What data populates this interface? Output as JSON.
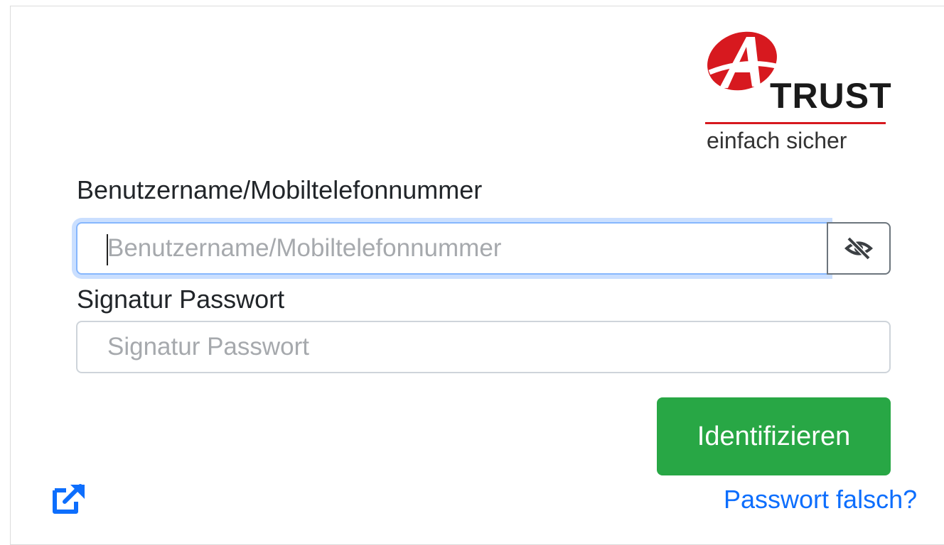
{
  "logo": {
    "brand": "TRUST",
    "tagline": "einfach sicher"
  },
  "form": {
    "username_label": "Benutzername/Mobiltelefonnummer",
    "username_placeholder": "Benutzername/Mobiltelefonnummer",
    "username_value": "",
    "password_label": "Signatur Passwort",
    "password_placeholder": "Signatur Passwort",
    "password_value": "",
    "toggle_icon": "eye-slash-icon",
    "submit_label": "Identifizieren"
  },
  "footer": {
    "external_icon": "external-link-icon",
    "forgot_password": "Passwort falsch?"
  },
  "colors": {
    "brand_red": "#d7191f",
    "submit_green": "#28a745",
    "link_blue": "#0d6efd",
    "focus_border": "#86b7fe"
  }
}
